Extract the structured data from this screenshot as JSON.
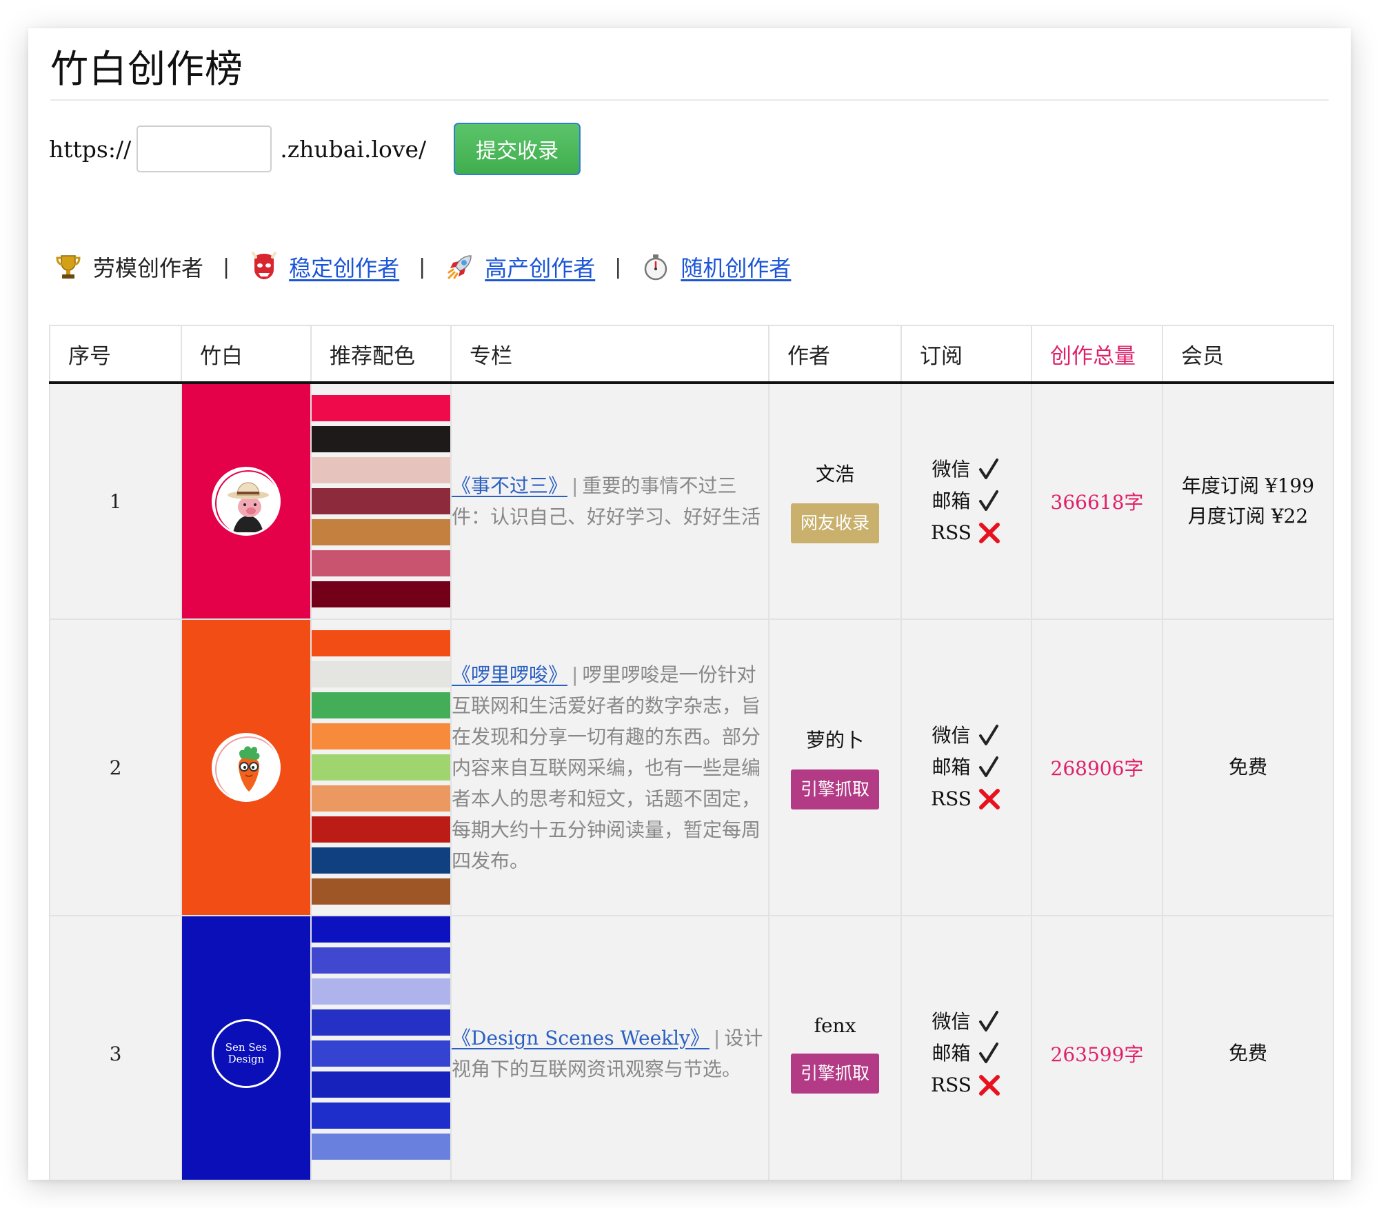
{
  "page": {
    "title": "竹白创作榜"
  },
  "submit": {
    "prefix": "https://",
    "input_value": "",
    "suffix": ".zhubai.love/",
    "button_label": "提交收录"
  },
  "filters": [
    {
      "label": "劳模创作者",
      "icon": "trophy-icon",
      "link": false
    },
    {
      "label": "稳定创作者",
      "icon": "oni-mask-icon",
      "link": true
    },
    {
      "label": "高产创作者",
      "icon": "rocket-icon",
      "link": true
    },
    {
      "label": "随机创作者",
      "icon": "stopwatch-icon",
      "link": true
    }
  ],
  "filter_separator": "|",
  "table": {
    "headers": [
      "序号",
      "竹白",
      "推荐配色",
      "专栏",
      "作者",
      "订阅",
      "创作总量",
      "会员"
    ],
    "rows": [
      {
        "index": "1",
        "bg_color": "#e5004a",
        "avatar": "pig-with-hat-avatar",
        "palette": [
          "#ee0a4b",
          "#1e1a1a",
          "#e6c3bc",
          "#8d2a3c",
          "#c4803f",
          "#c95470",
          "#730018"
        ],
        "column_title": "《事不过三》",
        "column_desc": "重要的事情不过三件：认识自己、好好学习、好好生活",
        "author": "文浩",
        "tag": "网友收录",
        "tag_color": "#c9b06d",
        "sub_wechat": "微信",
        "sub_email": "邮箱",
        "sub_rss": "RSS",
        "total": "366618字",
        "member_lines": [
          "年度订阅 ¥199",
          "月度订阅 ¥22"
        ]
      },
      {
        "index": "2",
        "bg_color": "#f24d14",
        "avatar": "carrot-avatar",
        "palette": [
          "#f24d14",
          "#e4e4e0",
          "#44ad58",
          "#f88a3c",
          "#9fd46e",
          "#ec9961",
          "#bb1c15",
          "#10407f",
          "#9e5627"
        ],
        "column_title": "《啰里啰唆》",
        "column_desc": "啰里啰唆是一份针对互联网和生活爱好者的数字杂志，旨在发现和分享一切有趣的东西。部分内容来自互联网采编，也有一些是编者本人的思考和短文，话题不固定，每期大约十五分钟阅读量，暂定每周四发布。",
        "author": "萝的卜",
        "tag": "引擎抓取",
        "tag_color": "#b33a85",
        "sub_wechat": "微信",
        "sub_email": "邮箱",
        "sub_rss": "RSS",
        "total": "268906字",
        "member_lines": [
          "免费"
        ]
      },
      {
        "index": "3",
        "bg_color": "#0a0fb7",
        "avatar": "scenes-design-logo",
        "avatar_text": "Sen Ses Design",
        "palette": [
          "#0c12c0",
          "#4048cf",
          "#aeb3ec",
          "#2530c5",
          "#3444d1",
          "#1722bc",
          "#1d2ecb",
          "#6a80df"
        ],
        "column_title": "《Design Scenes Weekly》",
        "column_desc": "设计视角下的互联网资讯观察与节选。",
        "author": "fenx",
        "tag": "引擎抓取",
        "tag_color": "#b33a85",
        "sub_wechat": "微信",
        "sub_email": "邮箱",
        "sub_rss": "RSS",
        "total": "263599字",
        "member_lines": [
          "免费"
        ]
      }
    ]
  },
  "colors": {
    "highlight": "#e0206a",
    "link": "#1a55d8",
    "ok_mark": "#222222",
    "no_mark": "#e8121f"
  }
}
